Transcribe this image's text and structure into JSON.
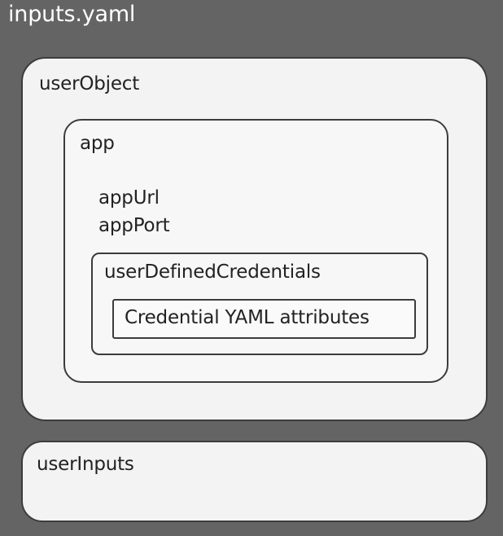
{
  "diagram": {
    "title": "inputs.yaml",
    "user_object": {
      "label": "userObject",
      "app": {
        "label": "app",
        "fields": [
          "appUrl",
          "appPort"
        ],
        "user_defined_credentials": {
          "label": "userDefinedCredentials",
          "attributes_label": "Credential YAML attributes"
        }
      }
    },
    "user_inputs": {
      "label": "userInputs"
    },
    "colors": {
      "background": "#646464",
      "box_fill": "#f3f3f3",
      "box_border": "#3c3c3c",
      "text": "#222222",
      "title_text": "#ffffff"
    }
  }
}
